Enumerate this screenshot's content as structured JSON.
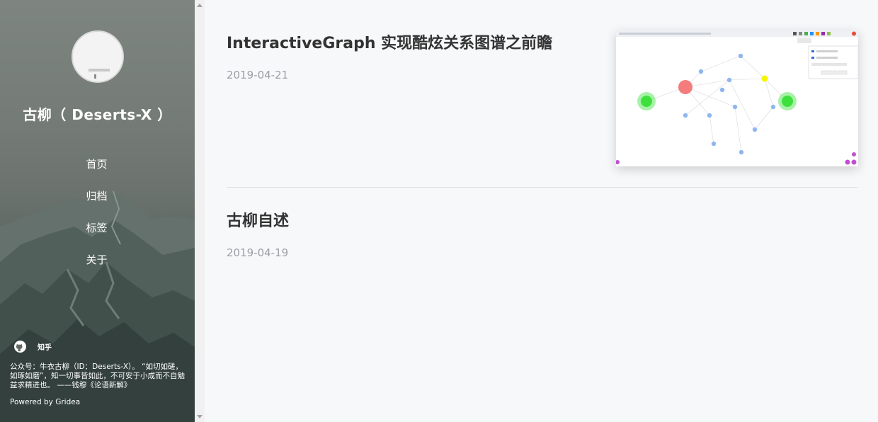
{
  "sidebar": {
    "site_title": "古柳（ Deserts-X ）",
    "menu": [
      {
        "label": "首页"
      },
      {
        "label": "归档"
      },
      {
        "label": "标签"
      },
      {
        "label": "关于"
      }
    ],
    "social": {
      "github_icon": "github-icon",
      "zhihu_label": "知乎"
    },
    "footer_text": "公众号：牛衣古柳（ID：Deserts-X）。 “如切如磋，如琢如磨”，知一切事皆如此，不可安于小成而不自勉益求精进也。 ——钱穆《论语新解》",
    "powered_by": "Powered by Gridea"
  },
  "posts": [
    {
      "title": "InteractiveGraph 实现酷炫关系图谱之前瞻",
      "date": "2019-04-21"
    },
    {
      "title": "古柳自述",
      "date": "2019-04-19"
    }
  ],
  "colors": {
    "sidebar_bg": "#747b76",
    "main_bg": "#f7f8fa",
    "title": "#333333",
    "date": "#9aa0a6",
    "graph_red": "#f47c7c",
    "graph_green": "#3ee03e",
    "graph_yellow": "#f5f500",
    "graph_blue": "#8fb6f0"
  }
}
